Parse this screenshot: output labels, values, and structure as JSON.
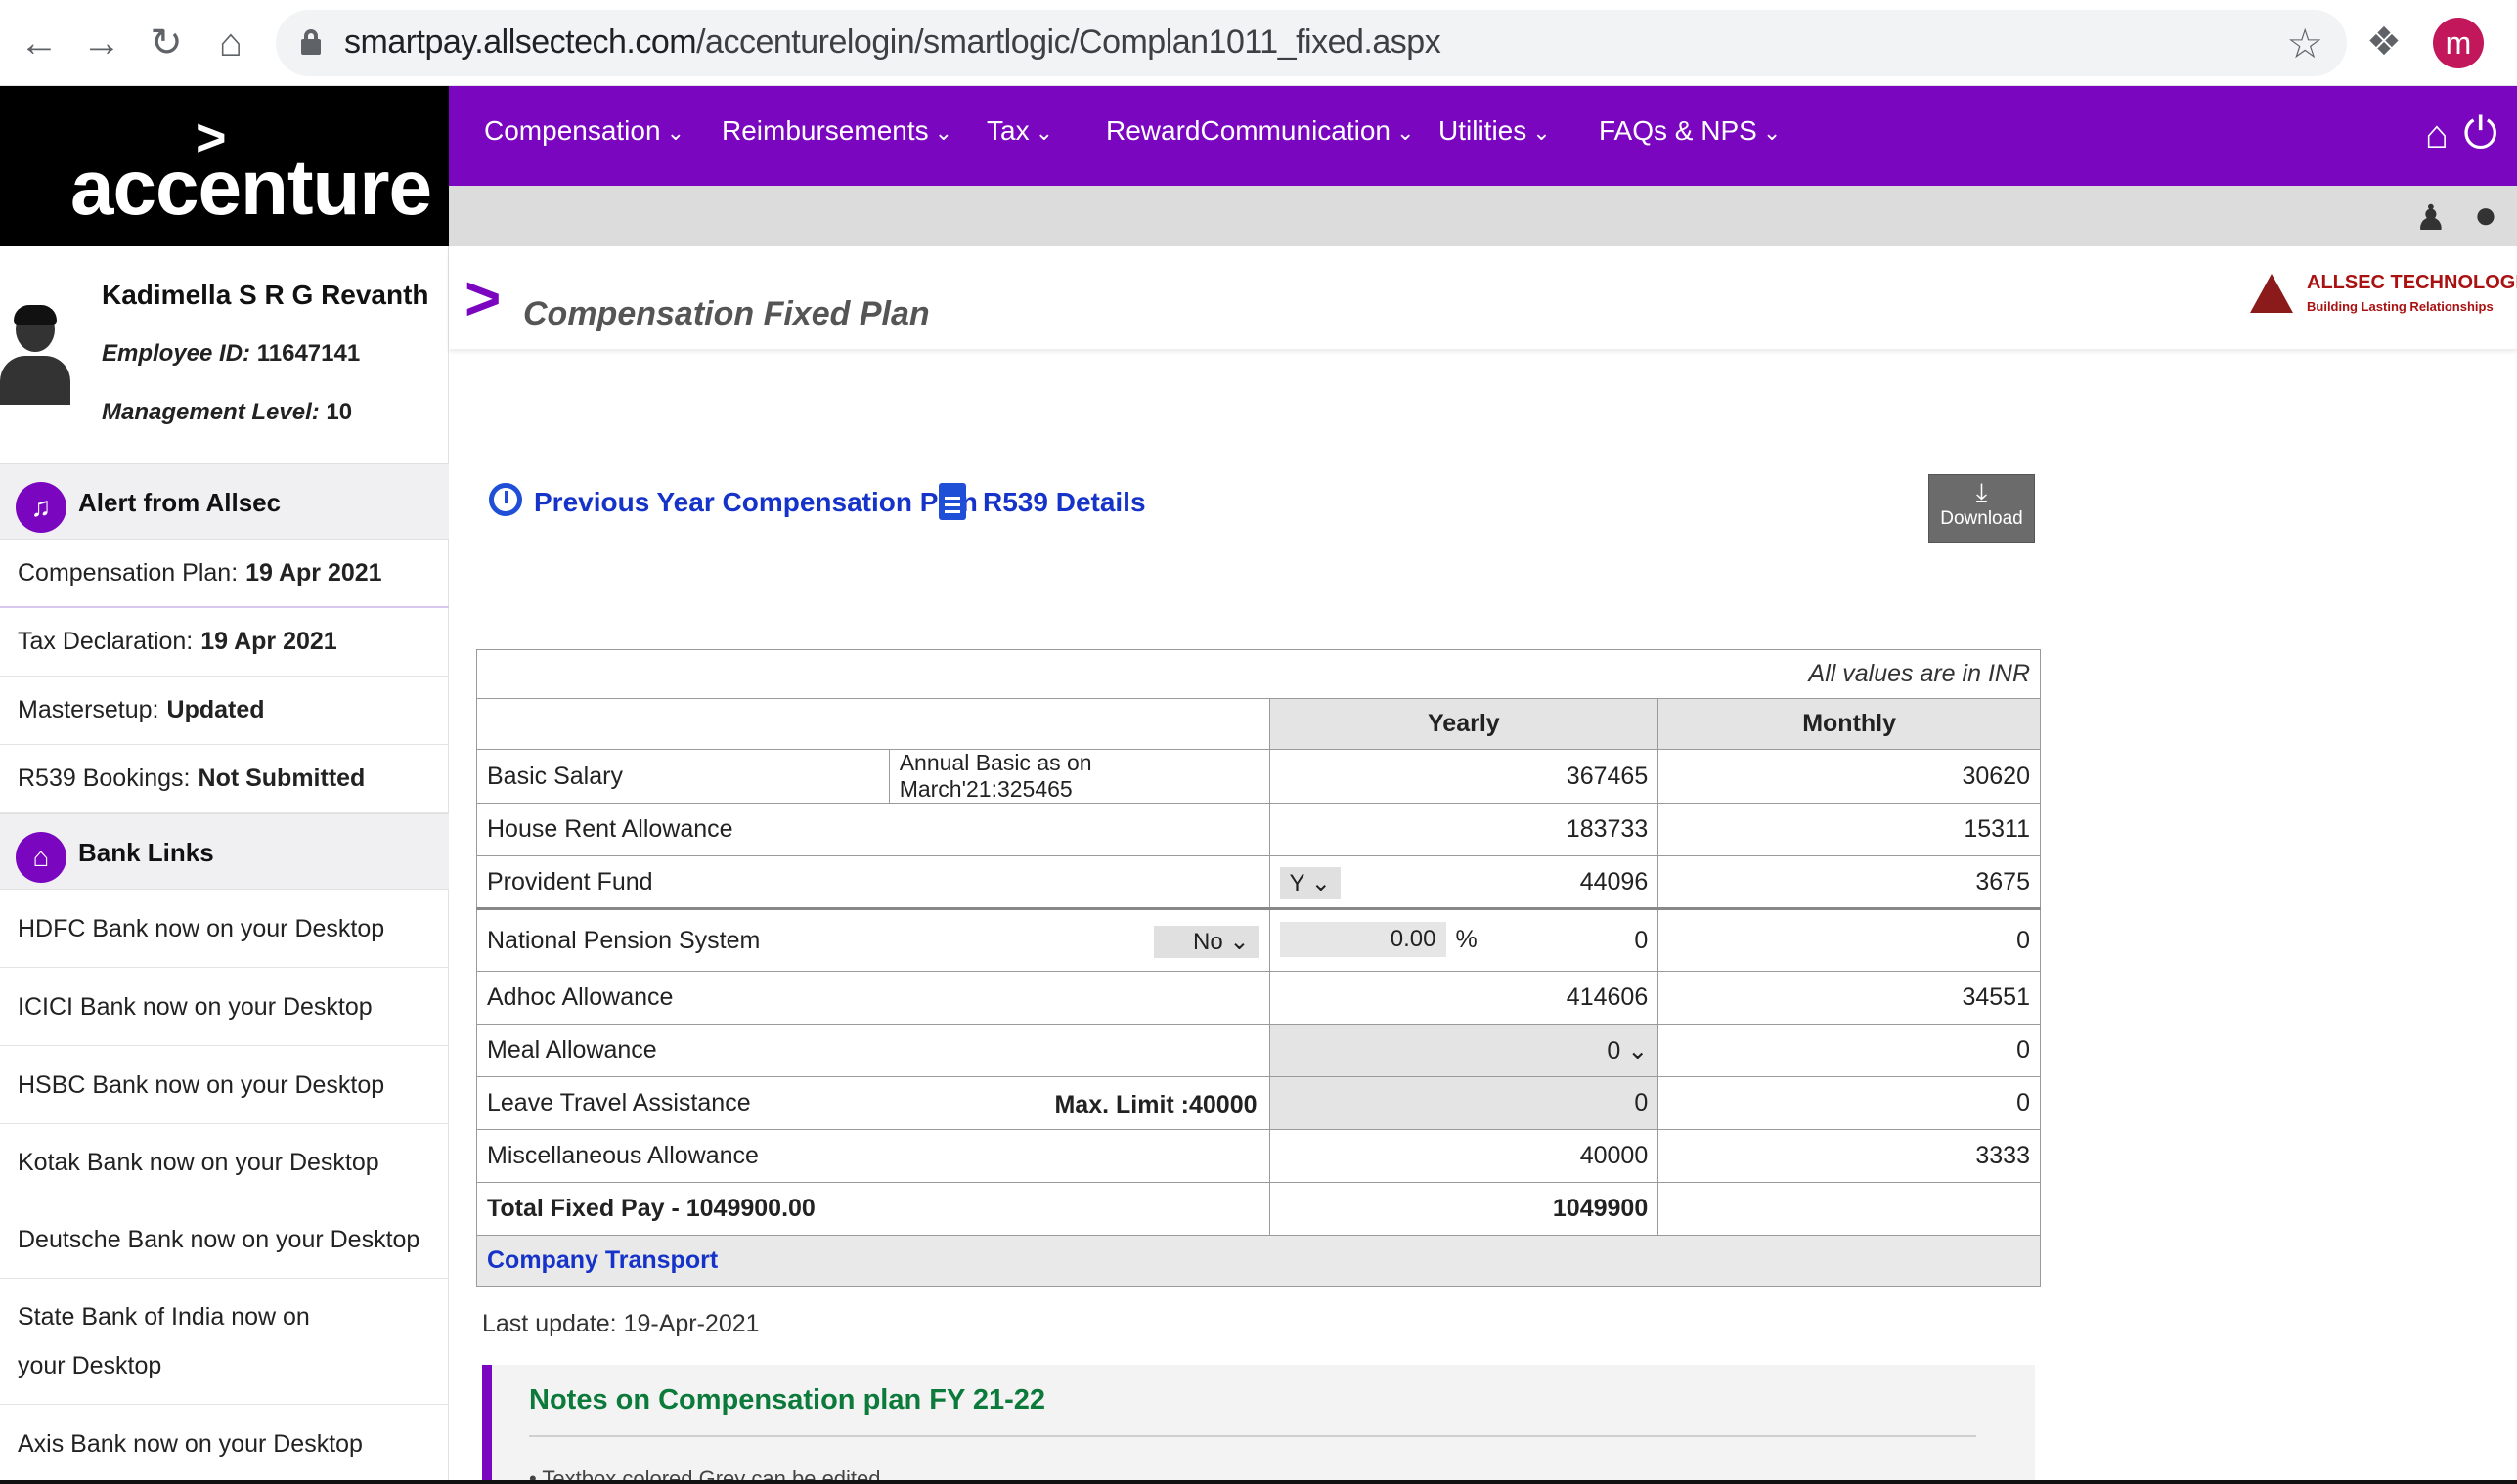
{
  "browser": {
    "url_host": "smartpay.allsectech.com",
    "url_path": "/accenturelogin/smartlogic/Complan1011_fixed.aspx",
    "profile_initial": "m"
  },
  "brand": {
    "logo_arrow": ">",
    "logo_text": "accenture"
  },
  "nav": {
    "items": [
      {
        "label": "Compensation"
      },
      {
        "label": "Reimbursements"
      },
      {
        "label": "Tax"
      },
      {
        "label": "RewardCommunication"
      },
      {
        "label": "Utilities"
      },
      {
        "label": "FAQs & NPS"
      }
    ]
  },
  "profile": {
    "name": "Kadimella S R G Revanth",
    "employee_id_label": "Employee ID:",
    "employee_id": "11647141",
    "level_label": "Management Level:",
    "level": "10"
  },
  "alerts": {
    "title": "Alert from Allsec",
    "rows": [
      {
        "label": "Compensation Plan:",
        "value": "19 Apr 2021"
      },
      {
        "label": "Tax Declaration:",
        "value": "19 Apr 2021"
      },
      {
        "label": "Mastersetup:",
        "value": "Updated"
      },
      {
        "label": "R539 Bookings:",
        "value": "Not Submitted"
      }
    ]
  },
  "bank_links": {
    "title": "Bank Links",
    "items": [
      "HDFC Bank now on your Desktop",
      "ICICI Bank now on your Desktop",
      "HSBC Bank now on your Desktop",
      "Kotak Bank now on your Desktop",
      "Deutsche Bank now on your Desktop",
      "State Bank of India now on your Desktop",
      "Axis Bank now on your Desktop"
    ]
  },
  "page": {
    "title": "Compensation Fixed Plan",
    "allsec_name": "ALLSEC TECHNOLOGIES",
    "allsec_tagline": "Building Lasting Relationships",
    "prev_link": "Previous Year Compensation Plan",
    "r539_link": "R539 Details",
    "download_label": "Download"
  },
  "table": {
    "inr_note": "All values are in INR",
    "col_yearly": "Yearly",
    "col_monthly": "Monthly",
    "basic": {
      "label": "Basic Salary",
      "note": "Annual Basic as on March'21:325465",
      "yearly": "367465",
      "monthly": "30620"
    },
    "hra": {
      "label": "House Rent Allowance",
      "yearly": "183733",
      "monthly": "15311"
    },
    "pf": {
      "label": "Provident Fund",
      "option": "Y",
      "yearly": "44096",
      "monthly": "3675"
    },
    "nps": {
      "label": "National Pension System",
      "option": "No",
      "percent": "0.00",
      "percent_sign": "%",
      "yearly": "0",
      "monthly": "0"
    },
    "adhoc": {
      "label": "Adhoc Allowance",
      "yearly": "414606",
      "monthly": "34551"
    },
    "meal": {
      "label": "Meal Allowance",
      "option": "0",
      "monthly": "0"
    },
    "lta": {
      "label": "Leave Travel Assistance",
      "limit": "Max. Limit :40000",
      "yearly": "0",
      "monthly": "0"
    },
    "misc": {
      "label": "Miscellaneous Allowance",
      "yearly": "40000",
      "monthly": "3333"
    },
    "total": {
      "label": "Total Fixed Pay - 1049900.00",
      "yearly": "1049900"
    },
    "transport": "Company Transport"
  },
  "last_update": "Last update: 19-Apr-2021",
  "notes": {
    "title": "Notes on Compensation plan FY 21-22",
    "first_item": "Textbox colored Grey can be edited"
  }
}
